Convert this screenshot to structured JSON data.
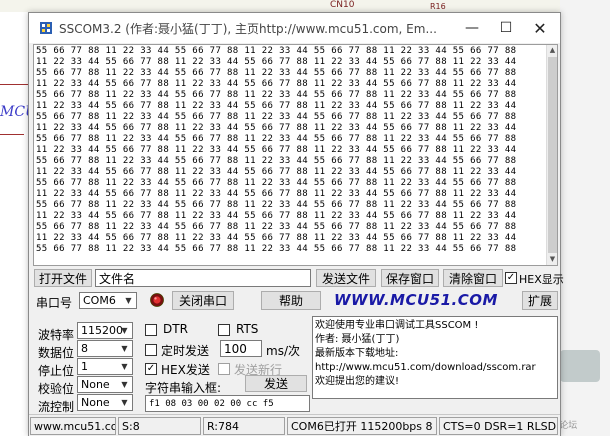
{
  "background": {
    "connector_label": "CN10",
    "ref_label": "R16",
    "side_fragment": "MCU",
    "watermark": "ST中文论坛"
  },
  "window": {
    "title": "SSCOM3.2 (作者:聂小猛(丁丁), 主页http://www.mcu51.com,  Em...",
    "minimize_glyph": "—",
    "maximize_glyph": "☐",
    "close_glyph": "✕"
  },
  "receive": {
    "lines": [
      "55 66 77 88 11 22 33 44 55 66 77 88 11 22 33 44 55 66 77 88 11 22 33 44 55 66 77 88",
      "11 22 33 44 55 66 77 88 11 22 33 44 55 66 77 88 11 22 33 44 55 66 77 88 11 22 33 44",
      "55 66 77 88 11 22 33 44 55 66 77 88 11 22 33 44 55 66 77 88 11 22 33 44 55 66 77 88",
      "11 22 33 44 55 66 77 88 11 22 33 44 55 66 77 88 11 22 33 44 55 66 77 88 11 22 33 44",
      "55 66 77 88 11 22 33 44 55 66 77 88 11 22 33 44 55 66 77 88 11 22 33 44 55 66 77 88",
      "11 22 33 44 55 66 77 88 11 22 33 44 55 66 77 88 11 22 33 44 55 66 77 88 11 22 33 44",
      "55 66 77 88 11 22 33 44 55 66 77 88 11 22 33 44 55 66 77 88 11 22 33 44 55 66 77 88",
      "11 22 33 44 55 66 77 88 11 22 33 44 55 66 77 88 11 22 33 44 55 66 77 88 11 22 33 44",
      "55 66 77 88 11 22 33 44 55 66 77 88 11 22 33 44 55 66 77 88 11 22 33 44 55 66 77 88",
      "11 22 33 44 55 66 77 88 11 22 33 44 55 66 77 88 11 22 33 44 55 66 77 88 11 22 33 44",
      "55 66 77 88 11 22 33 44 55 66 77 88 11 22 33 44 55 66 77 88 11 22 33 44 55 66 77 88",
      "11 22 33 44 55 66 77 88 11 22 33 44 55 66 77 88 11 22 33 44 55 66 77 88 11 22 33 44",
      "55 66 77 88 11 22 33 44 55 66 77 88 11 22 33 44 55 66 77 88 11 22 33 44 55 66 77 88",
      "11 22 33 44 55 66 77 88 11 22 33 44 55 66 77 88 11 22 33 44 55 66 77 88 11 22 33 44",
      "55 66 77 88 11 22 33 44 55 66 77 88 11 22 33 44 55 66 77 88 11 22 33 44 55 66 77 88",
      "11 22 33 44 55 66 77 88 11 22 33 44 55 66 77 88 11 22 33 44 55 66 77 88 11 22 33 44",
      "55 66 77 88 11 22 33 44 55 66 77 88 11 22 33 44 55 66 77 88 11 22 33 44 55 66 77 88",
      "11 22 33 44 55 66 77 88 11 22 33 44 55 66 77 88 11 22 33 44 55 66 77 88 11 22 33 44",
      "55 66 77 88 11 22 33 44 55 66 77 88 11 22 33 44 55 66 77 88 11 22 33 44 55 66 77 88"
    ]
  },
  "file_row": {
    "open_file_label": "打开文件",
    "file_name_value": "文件名",
    "send_file_label": "发送文件",
    "save_window_label": "保存窗口",
    "clear_window_label": "清除窗口",
    "hex_display_label": "HEX显示",
    "hex_display_checked": "✓"
  },
  "port_row": {
    "port_label": "串口号",
    "port_value": "COM6",
    "close_port_label": "关闭串口",
    "help_label": "帮助",
    "website_logo": "WWW.MCU51.COM",
    "expand_label": "扩展"
  },
  "settings": {
    "baud_label": "波特率",
    "baud_value": "115200",
    "databits_label": "数据位",
    "databits_value": "8",
    "stopbits_label": "停止位",
    "stopbits_value": "1",
    "parity_label": "校验位",
    "parity_value": "None",
    "flow_label": "流控制",
    "flow_value": "None"
  },
  "controls": {
    "dtr_label": "DTR",
    "rts_label": "RTS",
    "timed_send_label": "定时发送",
    "interval_value": "100",
    "interval_unit": "ms/次",
    "hex_send_label": "HEX发送",
    "hex_send_checked": "✓",
    "send_newline_label": "发送新行",
    "input_label": "字符串输入框:",
    "send_label": "发送",
    "send_value": "f1 08 03 00 02 00 cc f5"
  },
  "message": {
    "lines": [
      "欢迎使用专业串口调试工具SSCOM !",
      "作者: 聂小猛(丁丁)",
      "最新版本下载地址:",
      "http://www.mcu51.com/download/sscom.rar",
      "欢迎提出您的建议!"
    ]
  },
  "status": {
    "url": "www.mcu51.com",
    "s_count": "S:8",
    "r_count": "R:784",
    "port_state": "COM6已打开  115200bps  8",
    "signals": "CTS=0 DSR=1 RLSD"
  },
  "colors": {
    "logo_text": "#1a1aa6",
    "window_face": "#f0f0f0",
    "disabled_text": "#a0a0a0"
  }
}
